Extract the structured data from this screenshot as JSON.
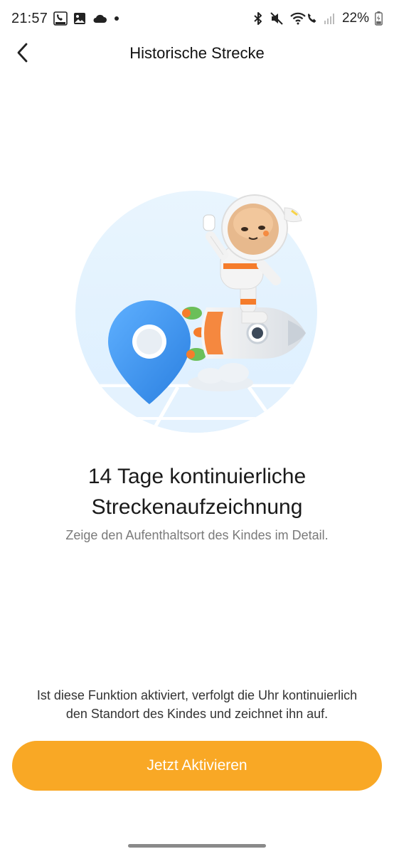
{
  "status_bar": {
    "time": "21:57",
    "battery": "22%",
    "icons_left": [
      "imoo-call-icon",
      "gallery-icon",
      "cloud-icon",
      "dot-icon"
    ],
    "icons_right": [
      "bluetooth-icon",
      "mute-icon",
      "wifi-call-icon",
      "signal-icon",
      "battery-icon"
    ]
  },
  "header": {
    "title": "Historische Strecke",
    "back_icon": "chevron-left-icon"
  },
  "illustration": {
    "description_icon": "astronaut-rocket-location-icon",
    "colors": {
      "circle": "#e3f2fd",
      "pin": "#3b8ee8",
      "suit": "#f2f2f2",
      "accent": "#f57c2b"
    }
  },
  "main": {
    "headline_line1": "14 Tage kontinuierliche",
    "headline_line2": "Streckenaufzeichnung",
    "subline": "Zeige den Aufenthaltsort des Kindes im Detail."
  },
  "footer": {
    "info_line1": "Ist diese Funktion aktiviert, verfolgt die Uhr kontinuierlich",
    "info_line2": "den Standort des Kindes und zeichnet ihn auf.",
    "button_label": "Jetzt Aktivieren",
    "button_color": "#f9a825"
  }
}
